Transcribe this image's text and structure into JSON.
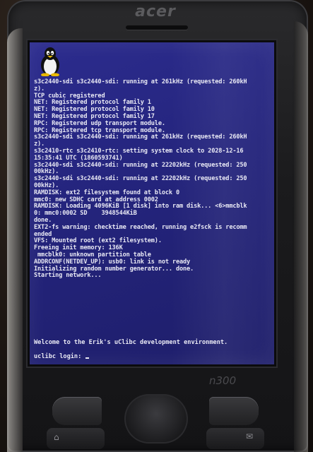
{
  "device": {
    "brand": "acer",
    "model": "n300"
  },
  "console_lines": [
    "s3c2440-sdi s3c2440-sdi: running at 261kHz (requested: 260kH",
    "z).",
    "TCP cubic registered",
    "NET: Registered protocol family 1",
    "NET: Registered protocol family 10",
    "NET: Registered protocol family 17",
    "RPC: Registered udp transport module.",
    "RPC: Registered tcp transport module.",
    "s3c2440-sdi s3c2440-sdi: running at 261kHz (requested: 260kH",
    "z).",
    "s3c2410-rtc s3c2410-rtc: setting system clock to 2028-12-16",
    "15:35:41 UTC (1860593741)",
    "s3c2440-sdi s3c2440-sdi: running at 22202kHz (requested: 250",
    "00kHz).",
    "s3c2440-sdi s3c2440-sdi: running at 22202kHz (requested: 250",
    "00kHz).",
    "RAMDISK: ext2 filesystem found at block 0",
    "mmc0: new SDHC card at address 0002",
    "RAMDISK: Loading 4096KiB [1 disk] into ram disk... <6>mmcblk",
    "0: mmc0:0002 SD    3948544KiB",
    "done.",
    "EXT2-fs warning: checktime reached, running e2fsck is recomm",
    "ended",
    "VFS: Mounted root (ext2 filesystem).",
    "Freeing init memory: 136K",
    " mmcblk0: unknown partition table",
    "ADDRCONF(NETDEV_UP): usb0: link is not ready",
    "Initializing random number generator... done.",
    "Starting network..."
  ],
  "welcome_message": "Welcome to the Erik's uClibc development environment.",
  "login_prompt": "uclibc login: ",
  "colors": {
    "screen_background": "#24247c",
    "console_text": "#e8e8f4",
    "device_body": "#1b1b1d"
  },
  "icons": {
    "tux": "tux-penguin-logo",
    "home": "home-icon",
    "mail": "mail-icon"
  }
}
